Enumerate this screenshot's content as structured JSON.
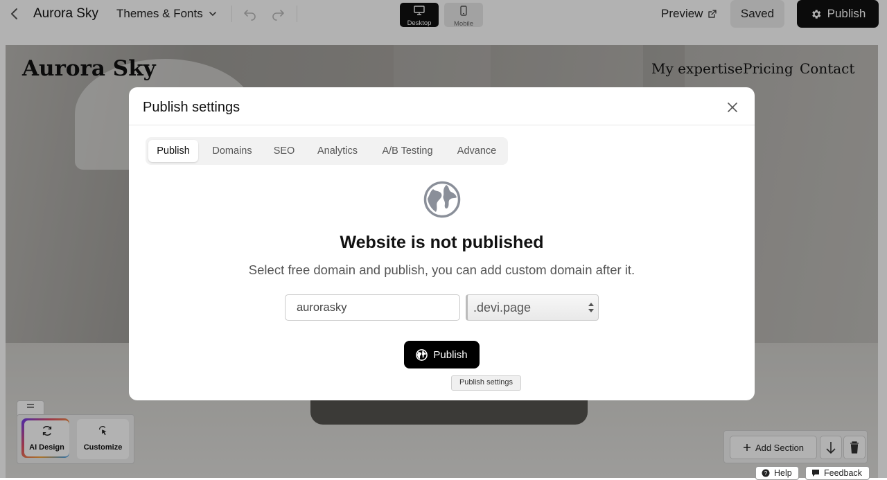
{
  "topbar": {
    "site_title": "Aurora Sky",
    "themes_label": "Themes & Fonts",
    "device_desktop": "Desktop",
    "device_mobile": "Mobile",
    "preview_label": "Preview",
    "saved_label": "Saved",
    "publish_label": "Publish"
  },
  "site": {
    "logo": "Aurora Sky",
    "nav": [
      "My expertise",
      "Pricing",
      "Contact"
    ]
  },
  "modal": {
    "title": "Publish settings",
    "tabs": [
      "Publish",
      "Domains",
      "SEO",
      "Analytics",
      "A/B Testing",
      "Advance"
    ],
    "active_tab": "Publish",
    "heading": "Website is not published",
    "subheading": "Select free domain and publish, you can add custom domain after it.",
    "domain_value": "aurorasky",
    "domain_suffix": ".devi.page",
    "publish_button": "Publish",
    "tooltip": "Publish settings"
  },
  "tools": {
    "ai_design": "AI Design",
    "customize": "Customize"
  },
  "section_bar": {
    "add_section": "Add Section"
  },
  "footer": {
    "help": "Help",
    "feedback": "Feedback"
  },
  "colors": {
    "primary": "#111111",
    "overlay": "rgba(0,0,0,0.30)",
    "modal_bg": "#ffffff"
  }
}
